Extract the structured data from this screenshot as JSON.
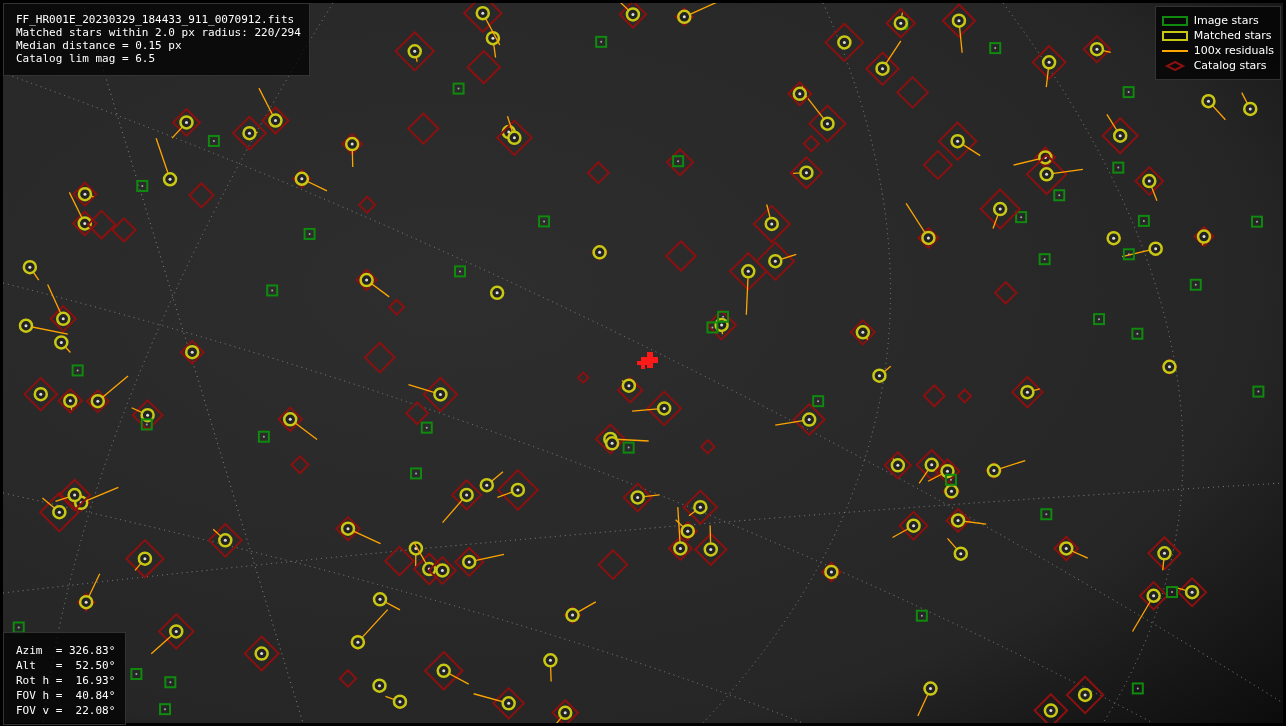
{
  "info_box": {
    "lines": [
      "FF_HR001E_20230329_184433_911_0070912.fits",
      "Matched stars within 2.0 px radius: 220/294",
      "Median distance = 0.15 px",
      "Catalog lim mag = 6.5"
    ]
  },
  "legend": {
    "items": [
      {
        "kind": "box",
        "label": "Image stars",
        "color": "#0f8a0f"
      },
      {
        "kind": "ring",
        "label": "Matched stars",
        "color": "#c8c814"
      },
      {
        "kind": "line",
        "label": "100x residuals",
        "color": "#ffa500"
      },
      {
        "kind": "diamond",
        "label": "Catalog stars",
        "color": "#8b1010"
      }
    ]
  },
  "pointing_box": {
    "lines": [
      "Azim  = 326.83°",
      "Alt   =  52.50°",
      "Rot h =  16.93°",
      "FOV h =  40.84°",
      "FOV v =  22.08°"
    ]
  }
}
